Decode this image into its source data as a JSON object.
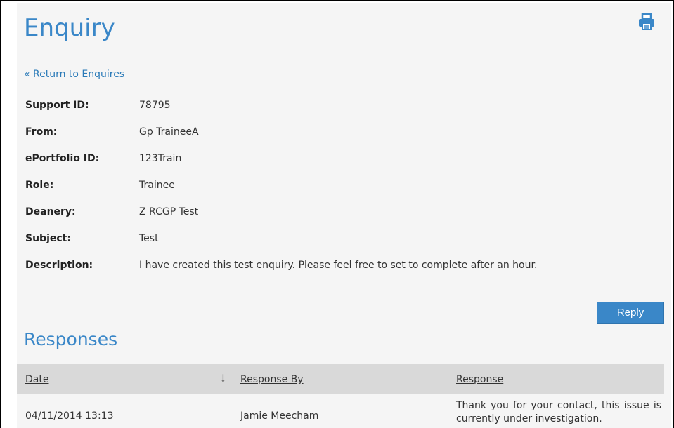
{
  "page": {
    "title": "Enquiry",
    "return_link": "« Return to Enquires"
  },
  "toolbar": {
    "print_icon": "printer-icon"
  },
  "details": [
    {
      "label": "Support ID:",
      "value": "78795"
    },
    {
      "label": "From:",
      "value": "Gp TraineeA"
    },
    {
      "label": "ePortfolio ID:",
      "value": "123Train"
    },
    {
      "label": "Role:",
      "value": "Trainee"
    },
    {
      "label": "Deanery:",
      "value": "Z RCGP Test"
    },
    {
      "label": "Subject:",
      "value": "Test"
    },
    {
      "label": "Description:",
      "value": "I have created this test enquiry. Please feel free to set to complete after an hour."
    }
  ],
  "actions": {
    "reply_label": "Reply"
  },
  "responses": {
    "title": "Responses",
    "columns": [
      "Date",
      "Response By",
      "Response"
    ],
    "sort_icon": "sort-down-arrow-icon",
    "rows": [
      {
        "date": "04/11/2014 13:13",
        "response_by": "Jamie Meecham",
        "response": "Thank you for your contact, this issue is currently under investigation."
      }
    ]
  },
  "colors": {
    "accent": "#3a87c8",
    "link": "#2a7ab8",
    "panel_background": "#f5f5f5",
    "table_header_background": "#d9d9d9"
  }
}
